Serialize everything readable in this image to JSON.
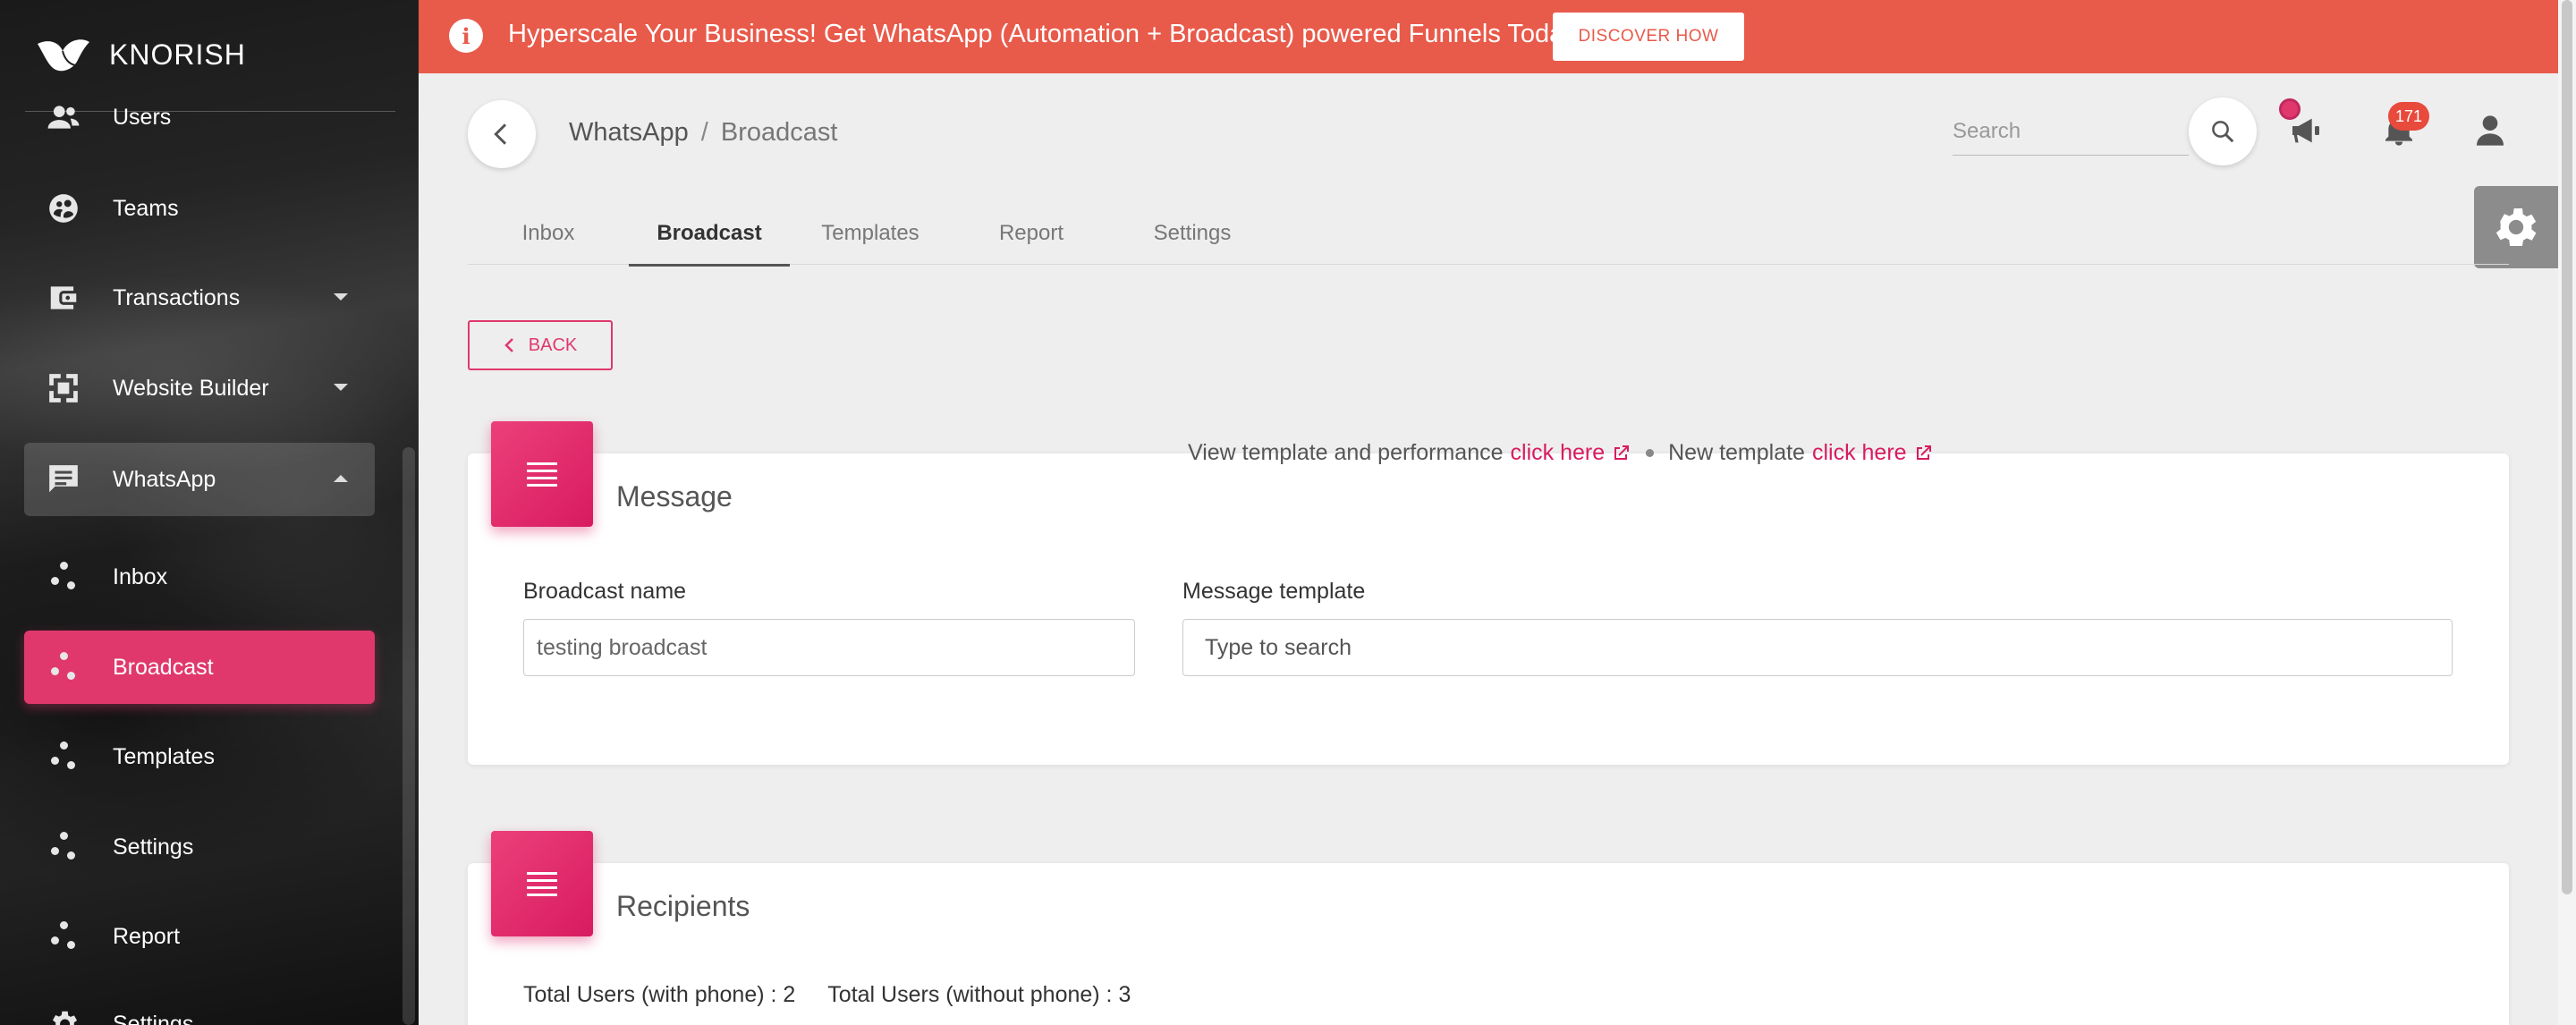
{
  "banner": {
    "text": "Hyperscale Your Business! Get WhatsApp (Automation + Broadcast) powered Funnels Today",
    "button_label": "DISCOVER HOW"
  },
  "sidebar": {
    "brand": "KNORISH",
    "items": [
      {
        "label": "Users",
        "icon": "users-icon"
      },
      {
        "label": "Teams",
        "icon": "teams-icon"
      },
      {
        "label": "Transactions",
        "icon": "wallet-icon",
        "expandable": true
      },
      {
        "label": "Website Builder",
        "icon": "website-builder-icon",
        "expandable": true
      },
      {
        "label": "WhatsApp",
        "icon": "chat-icon",
        "expanded": true
      },
      {
        "label": "Inbox",
        "icon": "dots-icon"
      },
      {
        "label": "Broadcast",
        "icon": "dots-icon",
        "active": true
      },
      {
        "label": "Templates",
        "icon": "dots-icon"
      },
      {
        "label": "Settings",
        "icon": "dots-icon"
      },
      {
        "label": "Report",
        "icon": "dots-icon"
      },
      {
        "label": "Settings",
        "icon": "gear-icon"
      }
    ]
  },
  "header": {
    "breadcrumb": [
      "WhatsApp",
      "Broadcast"
    ],
    "search_placeholder": "Search",
    "notification_count": "171"
  },
  "tabs": [
    "Inbox",
    "Broadcast",
    "Templates",
    "Report",
    "Settings"
  ],
  "active_tab": "Broadcast",
  "back_label": "BACK",
  "message_card": {
    "title": "Message",
    "broadcast_name_label": "Broadcast name",
    "broadcast_name_value": "testing broadcast",
    "template_label": "Message template",
    "template_placeholder": "Type to search",
    "view_template_text": "View template and performance",
    "view_template_link": "click here",
    "new_template_text": "New template",
    "new_template_link": "click here"
  },
  "recipients_card": {
    "title": "Recipients",
    "with_phone": "Total Users (with phone) : 2",
    "without_phone": "Total Users (without phone) : 3"
  },
  "colors": {
    "accent": "#e0386d",
    "banner": "#e85a4a"
  }
}
